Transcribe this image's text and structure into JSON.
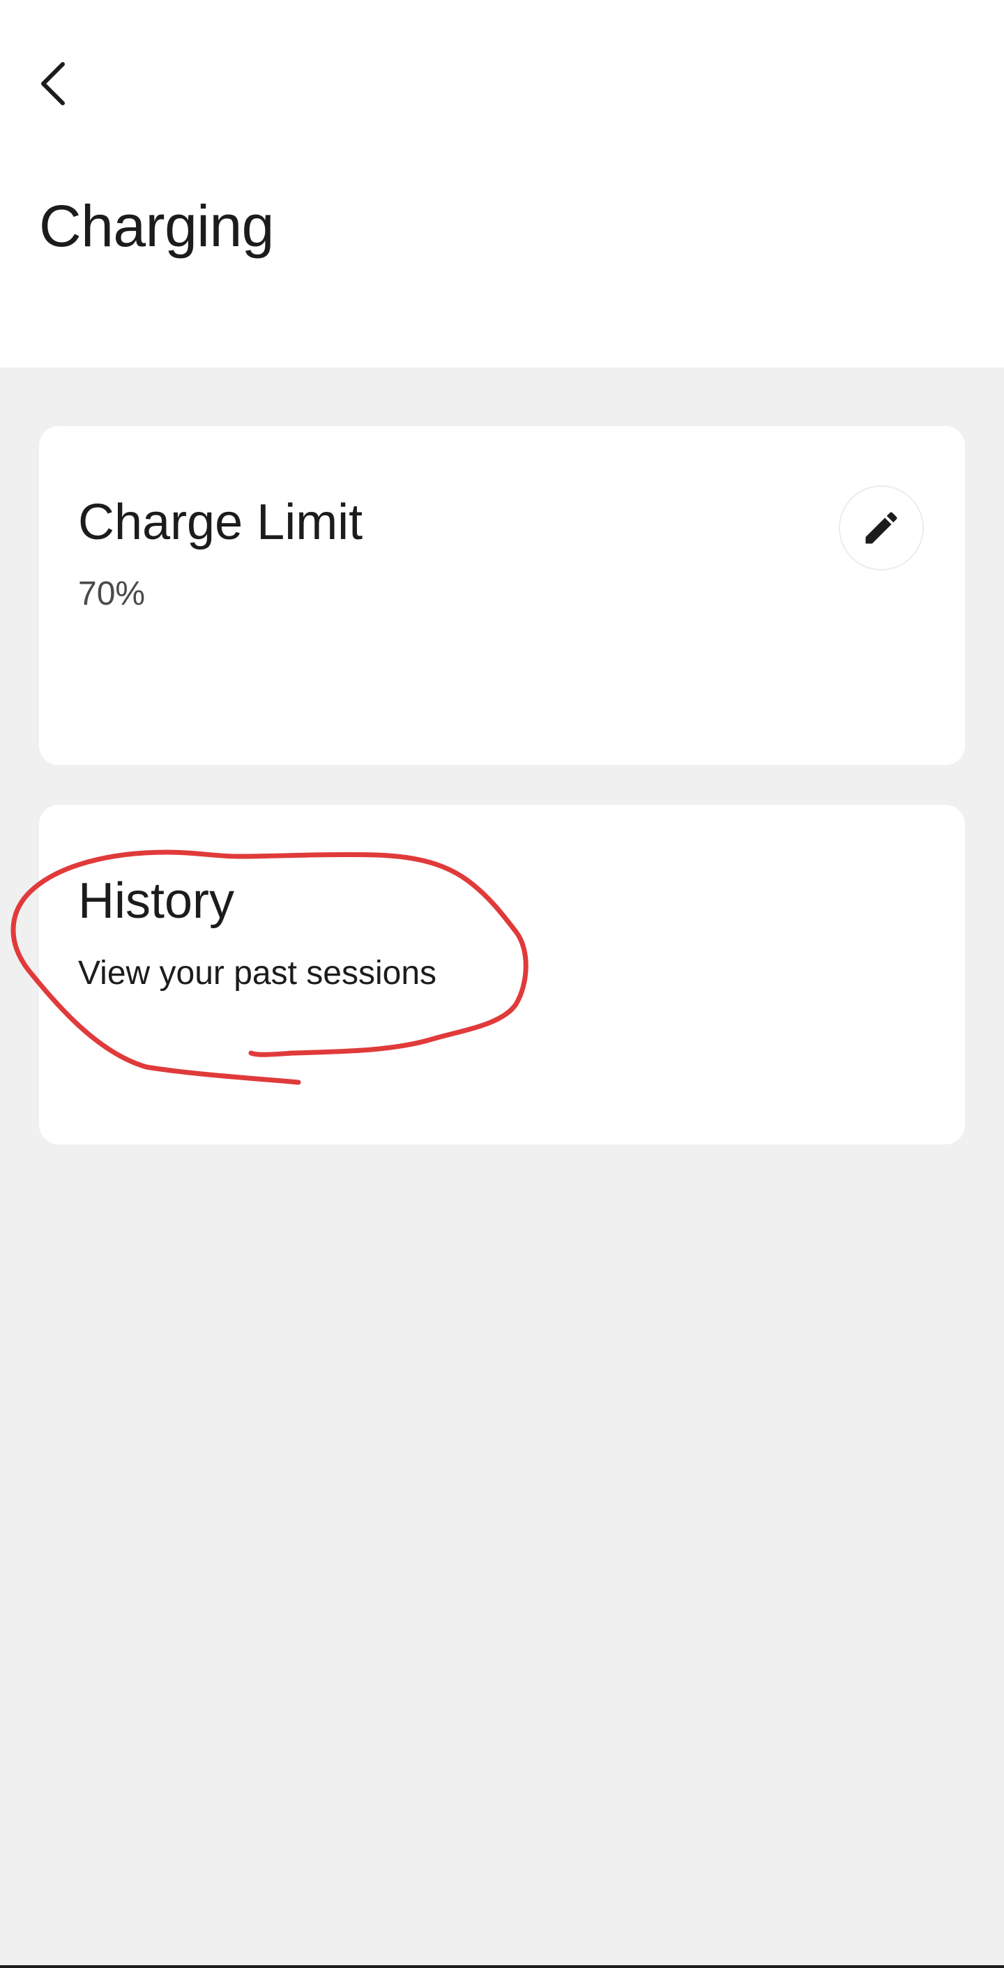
{
  "header": {
    "back_icon": "chevron-left-icon",
    "title": "Charging"
  },
  "charge_limit": {
    "title": "Charge Limit",
    "value": "70%",
    "edit_icon": "pencil-icon"
  },
  "history": {
    "title": "History",
    "subtitle": "View your past sessions"
  },
  "colors": {
    "annotation": "#e03a3a",
    "background": "#f0f0f0",
    "card": "#ffffff",
    "text": "#1c1c1c"
  }
}
